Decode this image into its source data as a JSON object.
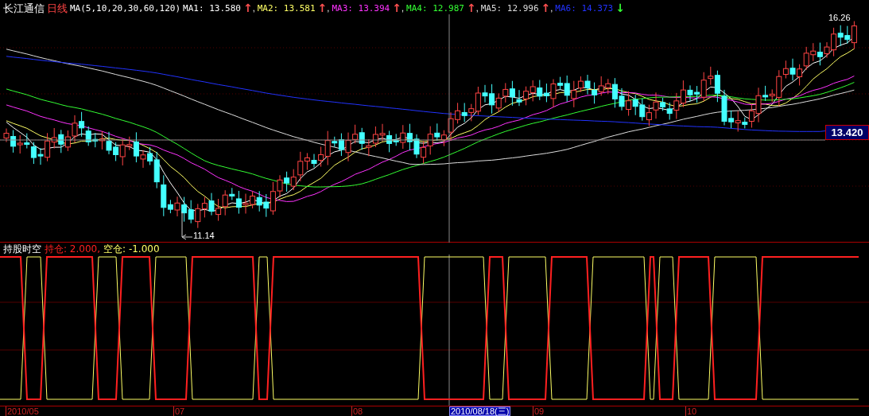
{
  "header": {
    "stock": "长江通信",
    "period": "日线",
    "ma_params": "MA(5,10,20,30,60,120)",
    "indicators": [
      {
        "label": "MA1:",
        "value": "13.580",
        "arrow": {
          "text": "↑",
          "color": "#ff5050"
        },
        "color": "#ffffff",
        "separator": ","
      },
      {
        "label": "MA2:",
        "value": "13.581",
        "arrow": {
          "text": "↑",
          "color": "#ff5050"
        },
        "color": "#ffff66",
        "separator": ","
      },
      {
        "label": "MA3:",
        "value": "13.394",
        "arrow": {
          "text": "↑",
          "color": "#ff5050"
        },
        "color": "#ff33ff",
        "separator": ","
      },
      {
        "label": "MA4:",
        "value": "12.987",
        "arrow": {
          "text": "↑",
          "color": "#ff5050"
        },
        "color": "#33ff33",
        "separator": ","
      },
      {
        "label": "MA5:",
        "value": "12.996",
        "arrow": {
          "text": "↑",
          "color": "#ff5050"
        },
        "color": "#dddddd",
        "separator": ","
      },
      {
        "label": "MA6:",
        "value": "14.373",
        "arrow": {
          "text": "↓",
          "color": "#33ff33"
        },
        "color": "#2233ff"
      }
    ]
  },
  "main_chart": {
    "high_label": "16.26",
    "low_label": "11.14",
    "price_tag": "13.420"
  },
  "sub_chart": {
    "title": "持股时空",
    "values": [
      {
        "label": "持仓:",
        "value": "2.000",
        "color": "#ff2020",
        "separator": ","
      },
      {
        "label": "空仓:",
        "value": "-1.000",
        "color": "#ffff66"
      }
    ]
  },
  "axis": {
    "dates": [
      "2010/05",
      "07",
      "08",
      "09",
      "10"
    ],
    "cursor_date": "2010/08/18(三)"
  }
}
